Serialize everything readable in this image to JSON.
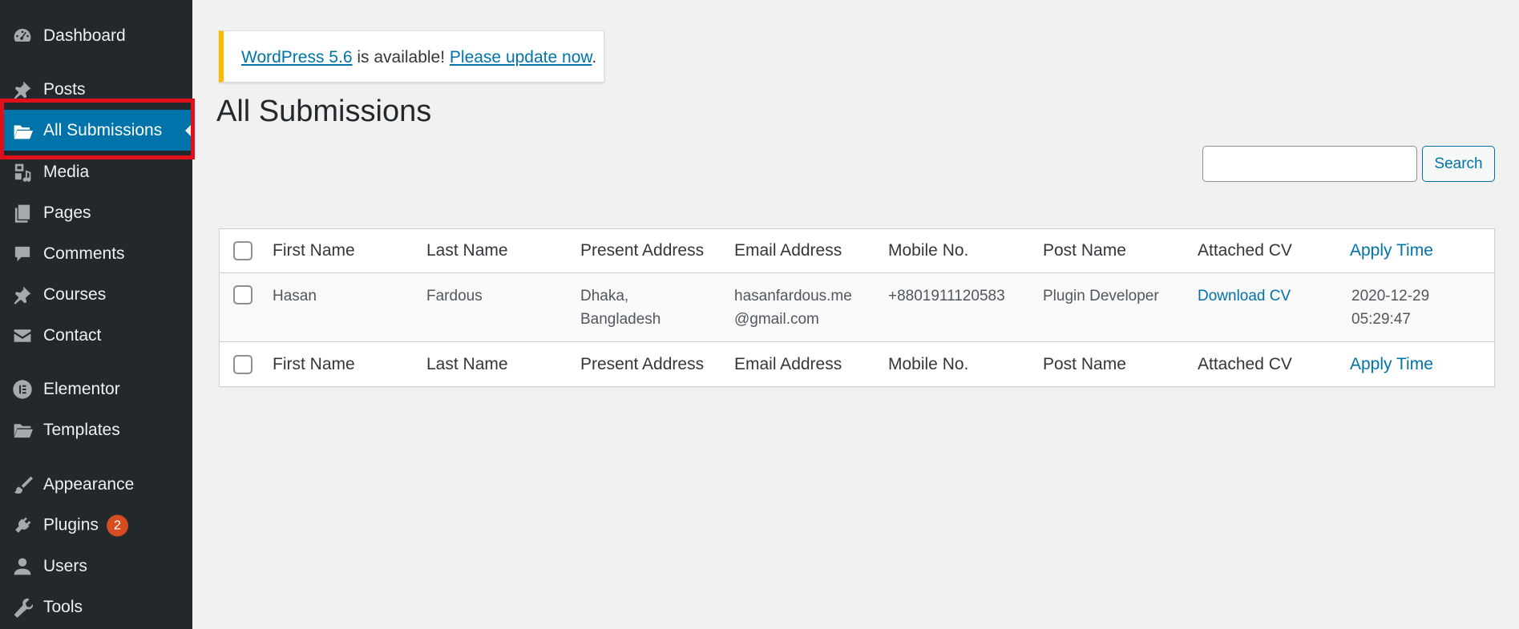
{
  "sidebar": {
    "items": [
      {
        "label": "Dashboard",
        "icon": "dashboard-icon"
      },
      {
        "label": "Posts",
        "icon": "pin-icon"
      },
      {
        "label": "All Submissions",
        "icon": "folder-open-icon",
        "active": true
      },
      {
        "label": "Media",
        "icon": "media-icon"
      },
      {
        "label": "Pages",
        "icon": "pages-icon"
      },
      {
        "label": "Comments",
        "icon": "comment-icon"
      },
      {
        "label": "Courses",
        "icon": "pin-icon"
      },
      {
        "label": "Contact",
        "icon": "mail-icon"
      },
      {
        "label": "Elementor",
        "icon": "elementor-icon"
      },
      {
        "label": "Templates",
        "icon": "folder-icon"
      },
      {
        "label": "Appearance",
        "icon": "brush-icon"
      },
      {
        "label": "Plugins",
        "icon": "plug-icon",
        "badge": "2"
      },
      {
        "label": "Users",
        "icon": "user-icon"
      },
      {
        "label": "Tools",
        "icon": "wrench-icon"
      }
    ]
  },
  "notice": {
    "version_link": "WordPress 5.6",
    "middle_text": " is available! ",
    "update_link": "Please update now",
    "end_text": "."
  },
  "page": {
    "title": "All Submissions"
  },
  "search": {
    "value": "",
    "button_label": "Search"
  },
  "table": {
    "columns": [
      "First Name",
      "Last Name",
      "Present Address",
      "Email Address",
      "Mobile No.",
      "Post Name",
      "Attached CV",
      "Apply Time"
    ],
    "rows": [
      {
        "first_name": "Hasan",
        "last_name": "Fardous",
        "present_address": "Dhaka, Bangladesh",
        "email": "hasanfardous.me@gmail.com",
        "mobile": "+8801911120583",
        "post_name": "Plugin Developer",
        "cv": "Download CV",
        "apply_time": "2020-12-29 05:29:47"
      }
    ]
  },
  "colors": {
    "sidebar_bg": "#23282d",
    "active_bg": "#0073aa",
    "link": "#0073aa",
    "notice_border": "#ffb900",
    "badge": "#d54e21",
    "highlight": "#e0101a"
  }
}
